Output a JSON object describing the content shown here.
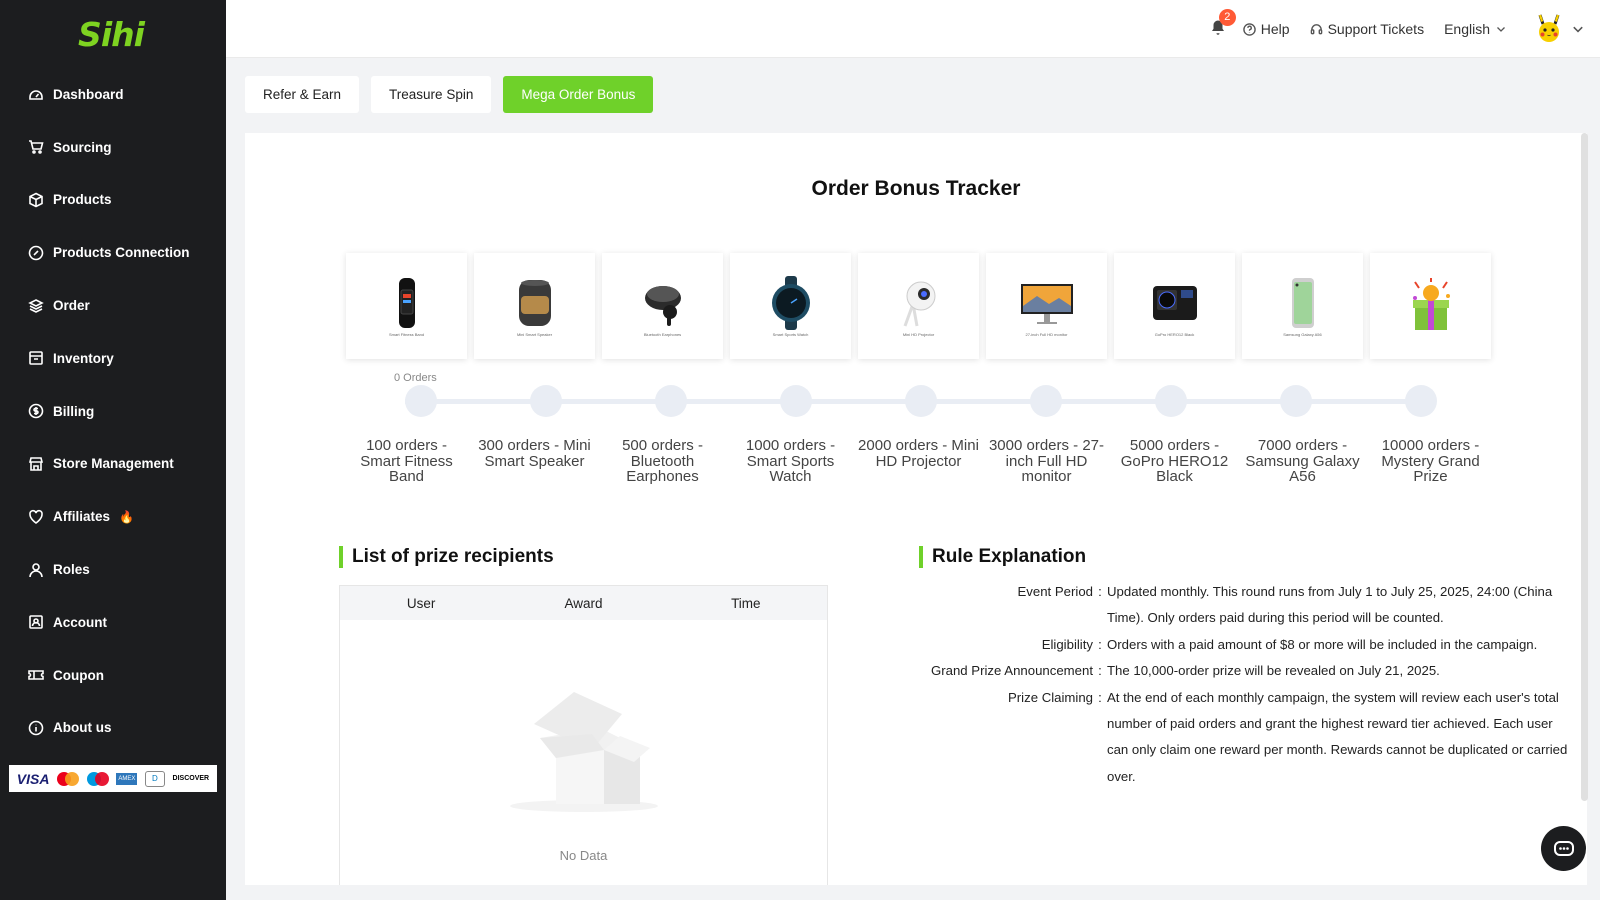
{
  "logo": "Sihi",
  "sidebar": {
    "items": [
      {
        "label": "Dashboard",
        "icon": "dashboard-icon"
      },
      {
        "label": "Sourcing",
        "icon": "cart-icon"
      },
      {
        "label": "Products",
        "icon": "box-icon"
      },
      {
        "label": "Products Connection",
        "icon": "link-icon"
      },
      {
        "label": "Order",
        "icon": "layers-icon"
      },
      {
        "label": "Inventory",
        "icon": "inventory-icon"
      },
      {
        "label": "Billing",
        "icon": "dollar-icon"
      },
      {
        "label": "Store Management",
        "icon": "store-icon"
      },
      {
        "label": "Affiliates",
        "icon": "heart-icon"
      },
      {
        "label": "Roles",
        "icon": "user-icon"
      },
      {
        "label": "Account",
        "icon": "account-icon"
      },
      {
        "label": "Coupon",
        "icon": "ticket-icon"
      },
      {
        "label": "About us",
        "icon": "info-icon"
      }
    ],
    "payments": [
      "VISA",
      "DISCOVER"
    ]
  },
  "topbar": {
    "notification_count": "2",
    "help": "Help",
    "support": "Support Tickets",
    "language": "English"
  },
  "tabs": [
    {
      "label": "Refer & Earn",
      "active": false
    },
    {
      "label": "Treasure Spin",
      "active": false
    },
    {
      "label": "Mega Order Bonus",
      "active": true
    }
  ],
  "tracker": {
    "title": "Order Bonus Tracker",
    "current_label": "0 Orders",
    "milestones": [
      {
        "label": "100 orders - Smart Fitness Band",
        "tiny": "Smart Fitness Band",
        "icon": "fitness-band-icon"
      },
      {
        "label": "300 orders - Mini Smart Speaker",
        "tiny": "Mini Smart Speaker",
        "icon": "speaker-icon"
      },
      {
        "label": "500 orders - Bluetooth Earphones",
        "tiny": "Bluetooth Earphones",
        "icon": "earphones-icon"
      },
      {
        "label": "1000 orders - Smart Sports Watch",
        "tiny": "Smart Sports Watch",
        "icon": "watch-icon"
      },
      {
        "label": "2000 orders - Mini HD Projector",
        "tiny": "Mini HD Projector",
        "icon": "projector-icon"
      },
      {
        "label": "3000 orders - 27-inch Full HD monitor",
        "tiny": "27-inch Full HD monitor",
        "icon": "monitor-icon"
      },
      {
        "label": "5000 orders - GoPro HERO12 Black",
        "tiny": "GoPro HERO12 Black",
        "icon": "camera-icon"
      },
      {
        "label": "7000 orders - Samsung Galaxy A56",
        "tiny": "Samsung Galaxy A56",
        "icon": "phone-icon"
      },
      {
        "label": "10000 orders - Mystery Grand Prize",
        "tiny": "",
        "icon": "gift-icon"
      }
    ]
  },
  "recipients": {
    "title": "List of prize recipients",
    "columns": [
      "User",
      "Award",
      "Time"
    ],
    "empty_text": "No Data"
  },
  "rules": {
    "title": "Rule Explanation",
    "items": [
      {
        "key": "Event Period",
        "value": "Updated monthly. This round runs from July 1 to July 25, 2025, 24:00 (China Time). Only orders paid during this period will be counted."
      },
      {
        "key": "Eligibility",
        "value": "Orders with a paid amount of $8 or more will be included in the campaign."
      },
      {
        "key": "Grand Prize Announcement",
        "value": "The 10,000-order prize will be revealed on July 21, 2025."
      },
      {
        "key": "Prize Claiming",
        "value": "At the end of each monthly campaign, the system will review each user's total number of paid orders and grant the highest reward tier achieved. Each user can only claim one reward per month. Rewards cannot be duplicated or carried over."
      }
    ]
  },
  "colors": {
    "accent": "#6fd12a",
    "sidebar_bg": "#1c1d1f",
    "badge": "#ff5a36"
  }
}
